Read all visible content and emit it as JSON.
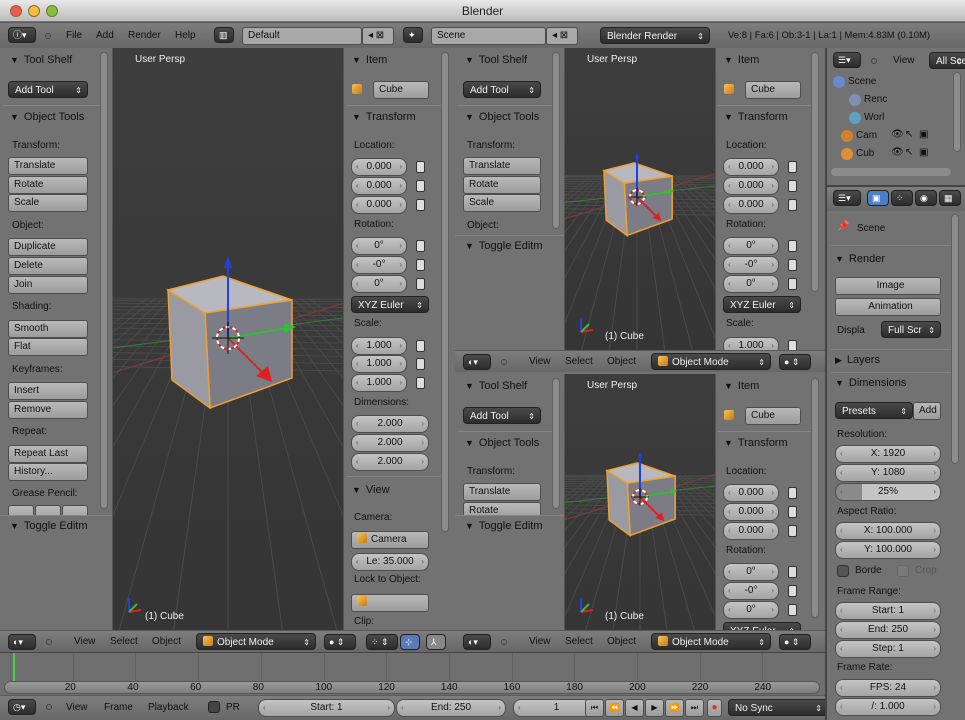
{
  "window": {
    "title": "Blender"
  },
  "topbar": {
    "menus": [
      "File",
      "Add",
      "Render",
      "Help"
    ],
    "layout": "Default",
    "scene": "Scene",
    "engine": "Blender Render",
    "stats": "Ve:8 | Fa:6 | Ob:3-1 | La:1 | Mem:4.83M (0.10M)"
  },
  "tool_shelf": {
    "title": "Tool Shelf",
    "add_tool": "Add Tool",
    "object_tools": "Object Tools",
    "transform_label": "Transform:",
    "transform": [
      "Translate",
      "Rotate",
      "Scale"
    ],
    "object_label": "Object:",
    "object": [
      "Duplicate",
      "Delete",
      "Join"
    ],
    "shading_label": "Shading:",
    "shading": [
      "Smooth",
      "Flat"
    ],
    "keyframes_label": "Keyframes:",
    "keyframes": [
      "Insert",
      "Remove"
    ],
    "repeat_label": "Repeat:",
    "repeat": [
      "Repeat Last",
      "History..."
    ],
    "grease_pencil_label": "Grease Pencil:",
    "toggle_editmode": "Toggle Editm"
  },
  "n_panel": {
    "item": "Item",
    "object_name": "Cube",
    "transform": "Transform",
    "location_label": "Location:",
    "location": [
      "0.000",
      "0.000",
      "0.000"
    ],
    "rotation_label": "Rotation:",
    "rotation": [
      "0°",
      "-0°",
      "0°"
    ],
    "rotation_mode": "XYZ Euler",
    "scale_label": "Scale:",
    "scale": [
      "1.000",
      "1.000",
      "1.000"
    ],
    "dimensions_label": "Dimensions:",
    "dimensions": [
      "2.000",
      "2.000",
      "2.000"
    ],
    "view": "View",
    "camera_label": "Camera:",
    "camera": "Camera",
    "lens": "Le: 35.000",
    "lock_label": "Lock to Object:",
    "clip_label": "Clip:"
  },
  "viewport": {
    "view_name": "User Persp",
    "object_label": "(1) Cube"
  },
  "view3d_header": {
    "menus": [
      "View",
      "Select",
      "Object"
    ],
    "mode": "Object Mode"
  },
  "timeline": {
    "ticks": [
      "20",
      "40",
      "60",
      "80",
      "100",
      "120",
      "140",
      "160",
      "180",
      "200",
      "220",
      "240"
    ],
    "menus": [
      "View",
      "Frame",
      "Playback"
    ],
    "pr_label": "PR",
    "start": "Start: 1",
    "end": "End: 250",
    "current_frame": "1",
    "sync": "No Sync",
    "current_frame_value": 1
  },
  "outliner": {
    "view_menu": "View",
    "filter": "All Sce",
    "tree": [
      "Scene",
      "Renc",
      "Worl",
      "Cam",
      "Cub"
    ]
  },
  "properties": {
    "scene": "Scene",
    "render_panel": "Render",
    "image_button": "Image",
    "animation_button": "Animation",
    "display_label": "Displa",
    "display_value": "Full Scr",
    "layers_panel": "Layers",
    "dimensions_panel": "Dimensions",
    "presets": "Presets",
    "add": "Add",
    "resolution_label": "Resolution:",
    "res_x": "X: 1920",
    "res_y": "Y: 1080",
    "res_percent": "25%",
    "res_percent_value": 25,
    "aspect_label": "Aspect Ratio:",
    "aspect_x": "X: 100.000",
    "aspect_y": "Y: 100.000",
    "border": "Borde",
    "crop": "Crop",
    "frame_range_label": "Frame Range:",
    "start": "Start: 1",
    "end": "End: 250",
    "step": "Step: 1",
    "frame_rate_label": "Frame Rate:",
    "fps": "FPS: 24",
    "fps_base": "/: 1.000"
  },
  "colors": {
    "accent_active_tab": "#4a7fc8",
    "x_axis": "#e02020",
    "y_axis": "#30c030",
    "z_axis": "#2040e0",
    "selection": "#f0a030"
  }
}
